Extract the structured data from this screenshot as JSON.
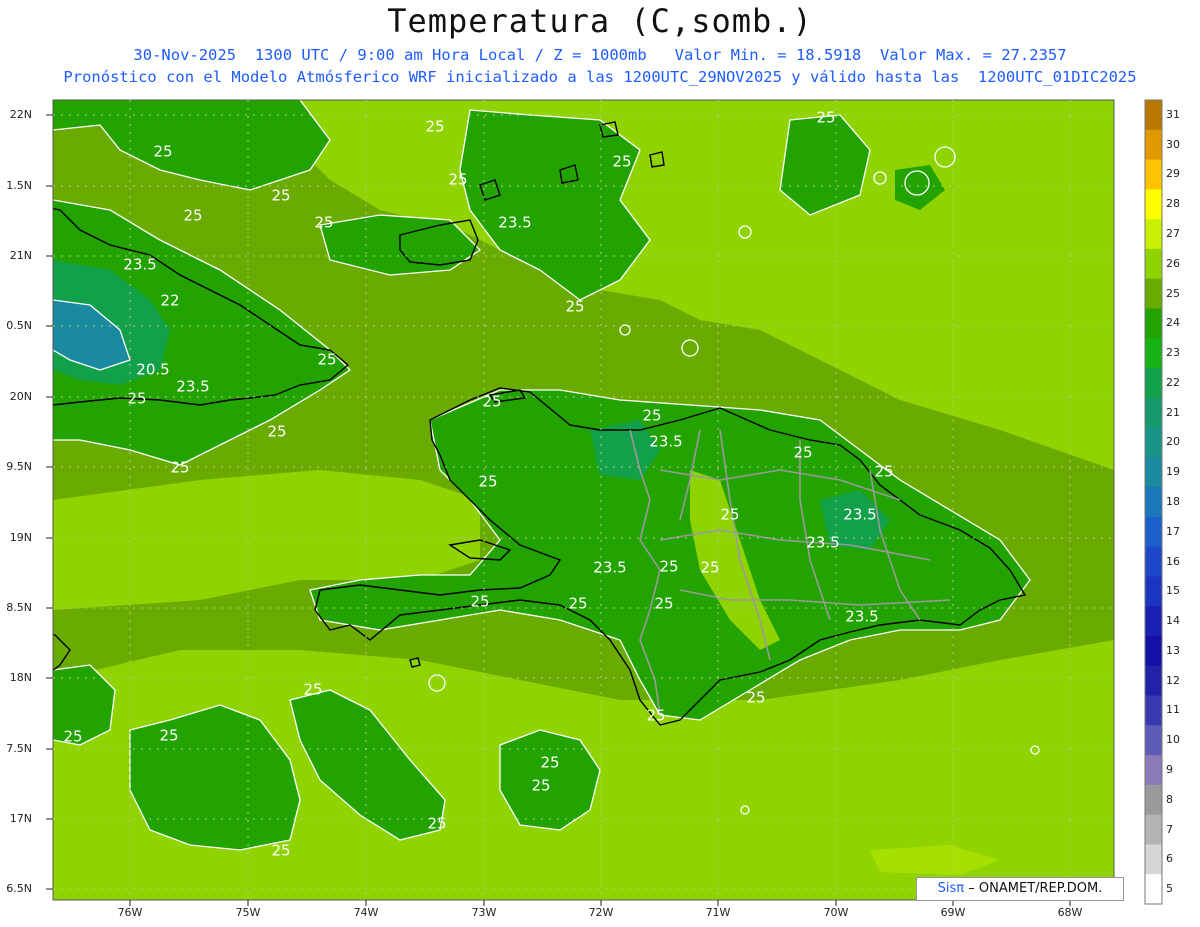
{
  "header": {
    "title": "Temperatura (C,somb.)",
    "line1": "30-Nov-2025  1300 UTC / 9:00 am Hora Local / Z = 1000mb   Valor Min. = 18.5918  Valor Max. = 27.2357",
    "line2": "Pronóstico con el Modelo Atmósferico WRF inicializado a las 1200UTC_29NOV2025 y válido hasta las  1200UTC_01DIC2025"
  },
  "axes": {
    "lat_labels": [
      "22N",
      "1.5N",
      "21N",
      "0.5N",
      "20N",
      "9.5N",
      "19N",
      "8.5N",
      "18N",
      "7.5N",
      "17N",
      "6.5N"
    ],
    "lon_labels": [
      "76W",
      "75W",
      "74W",
      "73W",
      "72W",
      "71W",
      "70W",
      "69W",
      "68W"
    ]
  },
  "colorbar": {
    "labels": [
      "31",
      "30",
      "29",
      "28",
      "27",
      "26",
      "25",
      "24",
      "23",
      "22",
      "21",
      "20",
      "19",
      "18",
      "17",
      "16",
      "15",
      "14",
      "13",
      "12",
      "11",
      "10",
      "9",
      "8",
      "7",
      "6",
      "5"
    ],
    "colors": [
      "#b87800",
      "#e09a00",
      "#ffc400",
      "#ffff00",
      "#c9f000",
      "#8fd400",
      "#6aab00",
      "#22a300",
      "#16b316",
      "#13a04a",
      "#159a6e",
      "#1a9488",
      "#1a8aa0",
      "#1b78b8",
      "#1b5fc8",
      "#1c47c8",
      "#1c35c0",
      "#1b20b5",
      "#1411a8",
      "#2222a8",
      "#3a3ab0",
      "#5c5cb8",
      "#8a7ab8",
      "#9a9a9a",
      "#b4b4b4",
      "#d6d6d6",
      "#ffffff"
    ]
  },
  "contours": {
    "labels": [
      {
        "text": "25"
      },
      {
        "text": "25"
      },
      {
        "text": "25"
      },
      {
        "text": "25"
      },
      {
        "text": "25"
      },
      {
        "text": "25"
      },
      {
        "text": "23.5"
      },
      {
        "text": "25"
      },
      {
        "text": "25"
      },
      {
        "text": "23.5"
      },
      {
        "text": "22"
      },
      {
        "text": "20.5"
      },
      {
        "text": "23.5"
      },
      {
        "text": "25"
      },
      {
        "text": "25"
      },
      {
        "text": "25"
      },
      {
        "text": "25"
      },
      {
        "text": "25"
      },
      {
        "text": "25"
      },
      {
        "text": "25"
      },
      {
        "text": "23.5"
      },
      {
        "text": "25"
      },
      {
        "text": "25"
      },
      {
        "text": "23.5"
      },
      {
        "text": "23.5"
      },
      {
        "text": "25"
      },
      {
        "text": "25"
      },
      {
        "text": "23.5"
      },
      {
        "text": "25"
      },
      {
        "text": "25"
      },
      {
        "text": "25"
      },
      {
        "text": "23.5"
      },
      {
        "text": "25"
      },
      {
        "text": "25"
      },
      {
        "text": "25"
      },
      {
        "text": "25"
      },
      {
        "text": "25"
      },
      {
        "text": "25"
      },
      {
        "text": "25"
      },
      {
        "text": "25"
      },
      {
        "text": "25"
      },
      {
        "text": "25"
      }
    ]
  },
  "credit": {
    "sis": "Sisπ",
    "text": "– ONAMET/REP.DOM."
  },
  "palette": {
    "field_base": "#6aab00",
    "field_light": "#8fd400",
    "field_green": "#22a300",
    "field_teal": "#13a04a",
    "field_deep": "#1a8aa0",
    "coast": "#000000",
    "provinces": "#9a9a9a",
    "isoline": "#ffffff"
  }
}
